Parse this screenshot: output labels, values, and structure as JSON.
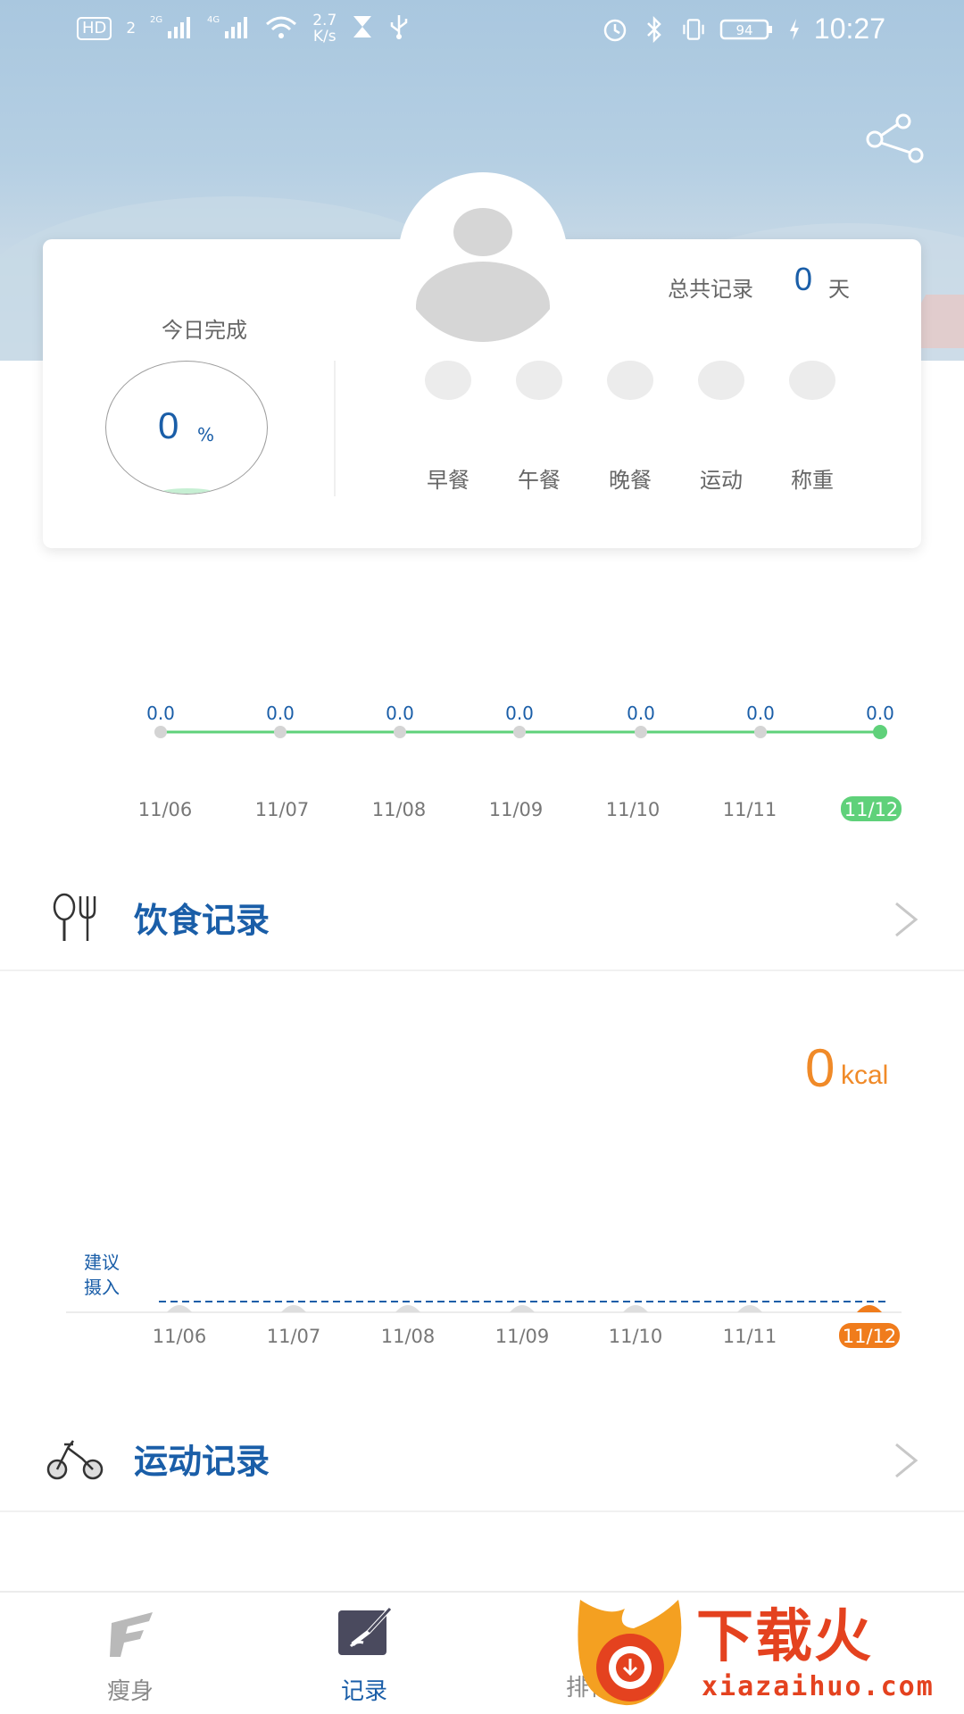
{
  "status_bar": {
    "hd": "HD",
    "sim2": "2",
    "net_2g": "2G",
    "net_4g": "4G",
    "speed_value": "2.7",
    "speed_unit": "K/s",
    "battery": "94",
    "time": "10:27"
  },
  "card": {
    "today_label": "今日完成",
    "progress_value": "0",
    "progress_unit": "%",
    "progress_fraction": 0,
    "total_label": "总共记录",
    "total_value": "0",
    "total_unit": "天",
    "tasks": [
      {
        "label": "早餐"
      },
      {
        "label": "午餐"
      },
      {
        "label": "晚餐"
      },
      {
        "label": "运动"
      },
      {
        "label": "称重"
      }
    ]
  },
  "chart_data": [
    {
      "type": "line",
      "categories": [
        "11/06",
        "11/07",
        "11/08",
        "11/09",
        "11/10",
        "11/11",
        "11/12"
      ],
      "values": [
        0.0,
        0.0,
        0.0,
        0.0,
        0.0,
        0.0,
        0.0
      ],
      "value_labels": [
        "0.0",
        "0.0",
        "0.0",
        "0.0",
        "0.0",
        "0.0",
        "0.0"
      ],
      "highlight_index": 6,
      "line_color": "#5fd17a",
      "highlight_color": "#5fd17a"
    },
    {
      "type": "bar",
      "categories": [
        "11/06",
        "11/07",
        "11/08",
        "11/09",
        "11/10",
        "11/11",
        "11/12"
      ],
      "values": [
        0,
        0,
        0,
        0,
        0,
        0,
        0
      ],
      "highlight_index": 6,
      "reference_line_label": [
        "建议",
        "摄入"
      ],
      "highlight_color": "#f07c1c"
    }
  ],
  "diet": {
    "title": "饮食记录",
    "kcal_value": "0",
    "kcal_unit": "kcal"
  },
  "exercise": {
    "title": "运动记录"
  },
  "nav": {
    "items": [
      {
        "label": "瘦身",
        "active": false
      },
      {
        "label": "记录",
        "active": true
      },
      {
        "label": "排行",
        "active": false
      }
    ]
  },
  "watermark": {
    "brand": "下载火",
    "url": "xiazaihuo.com"
  },
  "colors": {
    "primary": "#1a5ea8",
    "accent_green": "#5fd17a",
    "accent_orange": "#f07c1c",
    "watermark_red": "#e4421f"
  }
}
